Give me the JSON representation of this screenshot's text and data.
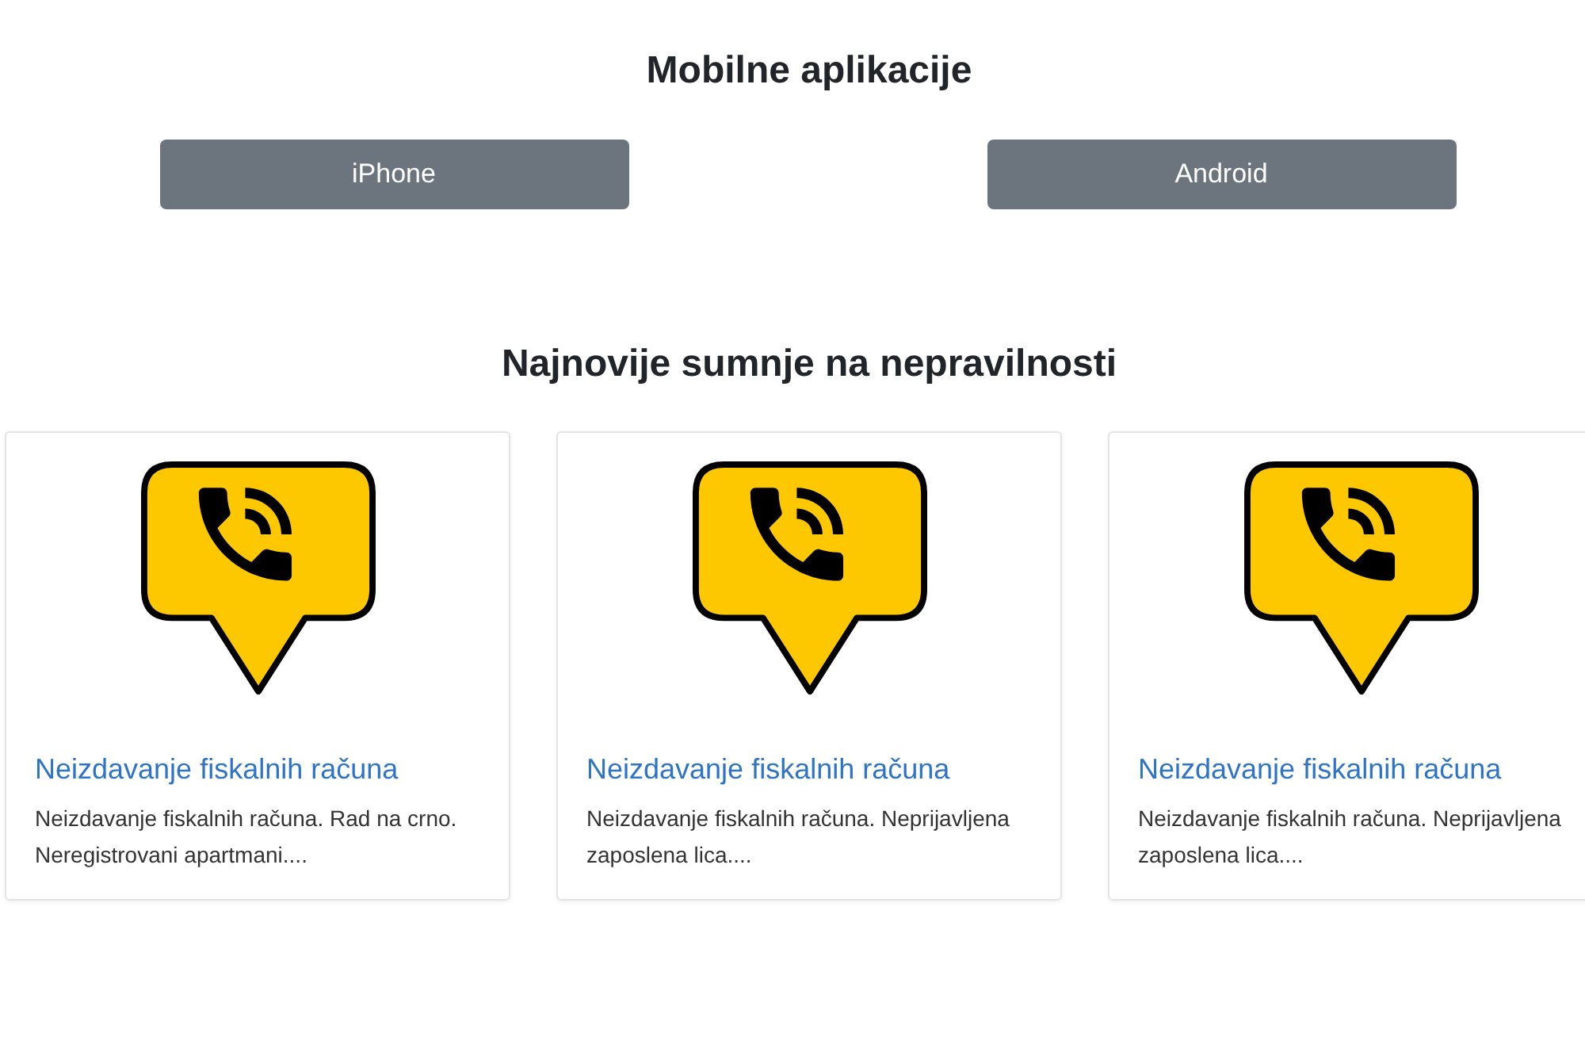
{
  "apps": {
    "title": "Mobilne aplikacije",
    "buttons": [
      {
        "label": "iPhone"
      },
      {
        "label": "Android"
      }
    ]
  },
  "reports": {
    "title": "Najnovije sumnje na nepravilnosti",
    "cards": [
      {
        "title": "Neizdavanje fiskalnih računa",
        "description": "Neizdavanje fiskalnih računa. Rad na crno. Neregistrovani apartmani...."
      },
      {
        "title": "Neizdavanje fiskalnih računa",
        "description": "Neizdavanje fiskalnih računa. Neprijavljena zaposlena lica...."
      },
      {
        "title": "Neizdavanje fiskalnih računa",
        "description": "Neizdavanje fiskalnih računa. Neprijavljena zaposlena lica...."
      }
    ]
  }
}
